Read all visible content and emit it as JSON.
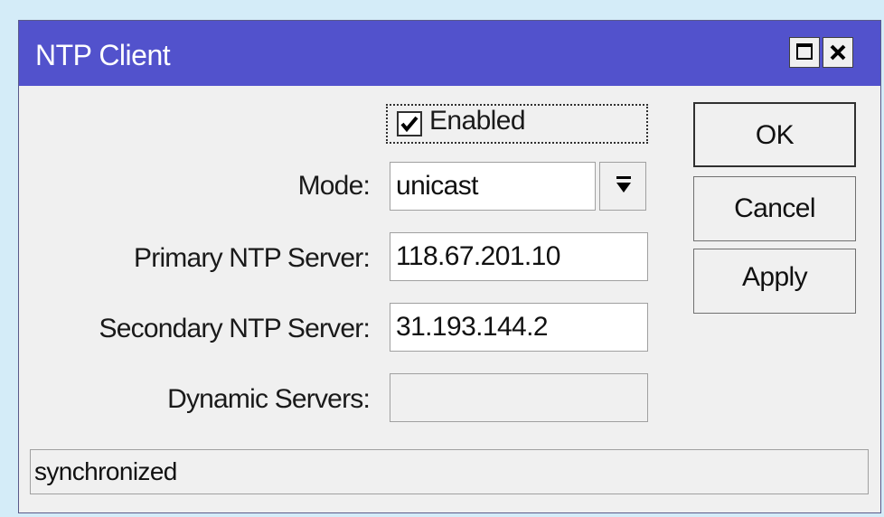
{
  "window": {
    "title": "NTP Client",
    "titlebar_color": "#5252cc"
  },
  "form": {
    "enabled_label": "Enabled",
    "enabled_checked": true,
    "mode_label": "Mode:",
    "mode_value": "unicast",
    "primary_label": "Primary NTP Server:",
    "primary_value": "118.67.201.10",
    "secondary_label": "Secondary NTP Server:",
    "secondary_value": "31.193.144.2",
    "dynamic_label": "Dynamic Servers:",
    "dynamic_value": ""
  },
  "buttons": {
    "ok": "OK",
    "cancel": "Cancel",
    "apply": "Apply"
  },
  "status": {
    "text": "synchronized"
  },
  "icons": {
    "maximize": "maximize-icon",
    "close": "close-icon",
    "dropdown": "dropdown-arrow-icon",
    "check": "checkmark-icon"
  }
}
